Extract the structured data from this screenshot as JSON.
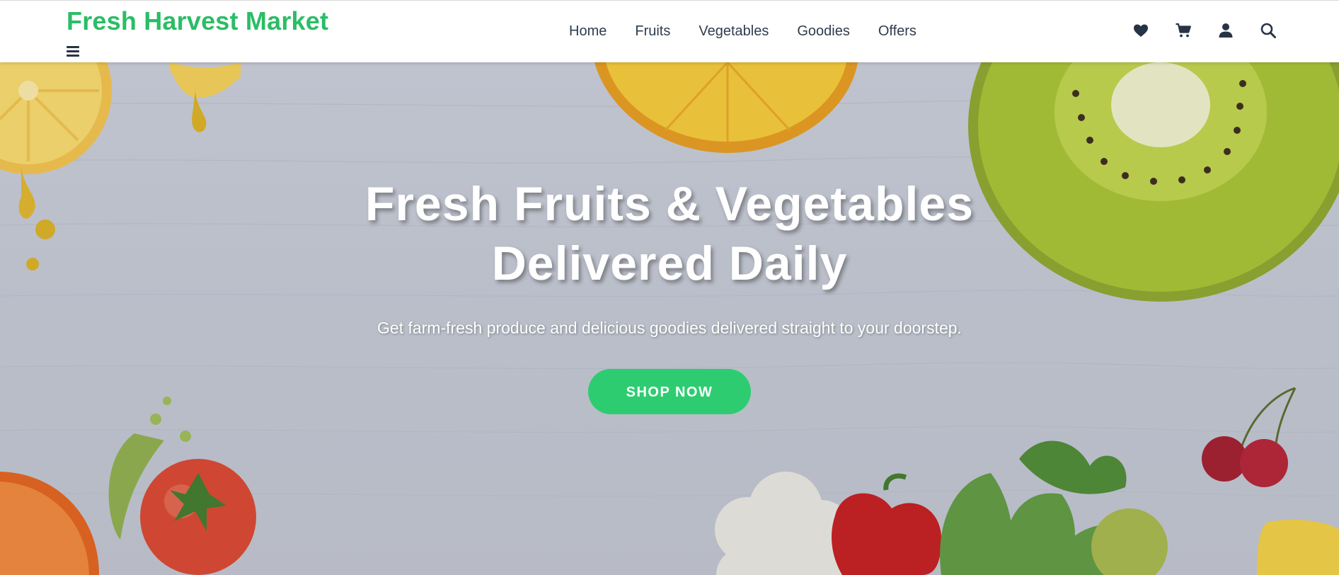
{
  "brand": {
    "name": "Fresh Harvest Market",
    "color": "#2bbd66"
  },
  "menu_toggle": {
    "icon": "hamburger-icon"
  },
  "nav": {
    "links": [
      {
        "label": "Home"
      },
      {
        "label": "Fruits"
      },
      {
        "label": "Vegetables"
      },
      {
        "label": "Goodies"
      },
      {
        "label": "Offers"
      }
    ],
    "icons": [
      "heart-icon",
      "cart-icon",
      "user-icon",
      "search-icon"
    ]
  },
  "hero": {
    "title": "Fresh Fruits & Vegetables Delivered Daily",
    "subtitle": "Get farm-fresh produce and delicious goodies delivered straight to your doorstep.",
    "cta_label": "SHOP NOW",
    "cta_color": "#2ecc71"
  }
}
